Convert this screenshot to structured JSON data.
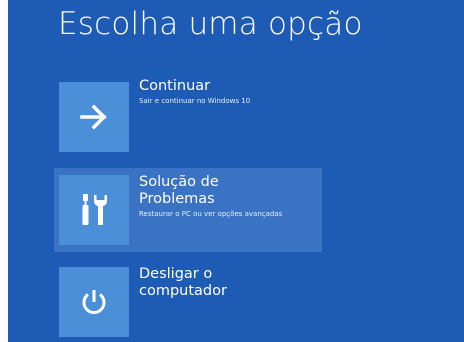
{
  "screen": {
    "title": "Escolha uma opção"
  },
  "options": [
    {
      "label_line1": "Continuar",
      "label_line2": "",
      "description": "Sair e continuar no Windows 10",
      "icon": "arrow-right-icon"
    },
    {
      "label_line1": "Solução de",
      "label_line2": "Problemas",
      "description": "Restaurar o PC ou ver opções avançadas",
      "icon": "tools-icon"
    },
    {
      "label_line1": "Desligar o",
      "label_line2": "computador",
      "description": "",
      "icon": "power-icon"
    }
  ],
  "colors": {
    "background": "#1e5bb5",
    "tile": "#4a8fd8",
    "highlight": "#3a72c4",
    "text": "#ffffff"
  }
}
